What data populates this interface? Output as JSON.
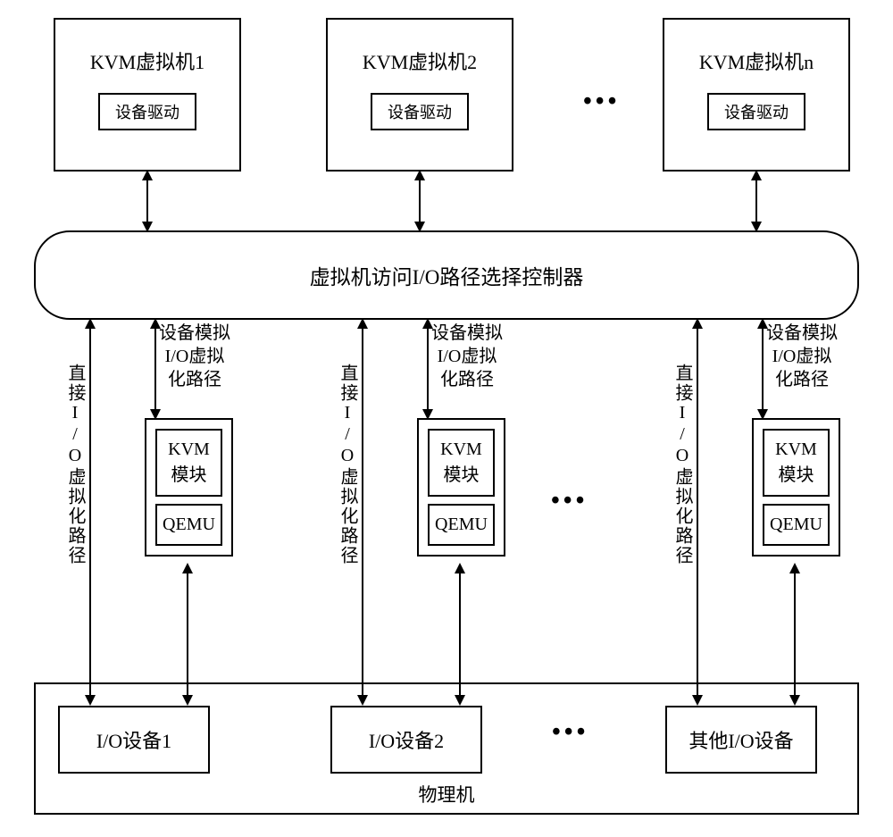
{
  "vms": [
    {
      "title": "KVM虚拟机1",
      "driver": "设备驱动"
    },
    {
      "title": "KVM虚拟机2",
      "driver": "设备驱动"
    },
    {
      "title": "KVM虚拟机n",
      "driver": "设备驱动"
    }
  ],
  "dots": "•••",
  "controller": "虚拟机访问I/O路径选择控制器",
  "direct_path_label": "直接I/O虚拟化路径",
  "emulation_path_label": {
    "line1": "设备模拟",
    "line2": "I/O虚拟",
    "line3": "化路径"
  },
  "modules": {
    "kvm": "KVM\n模块",
    "qemu": "QEMU"
  },
  "io_devices": [
    "I/O设备1",
    "I/O设备2",
    "其他I/O设备"
  ],
  "physical_label": "物理机"
}
